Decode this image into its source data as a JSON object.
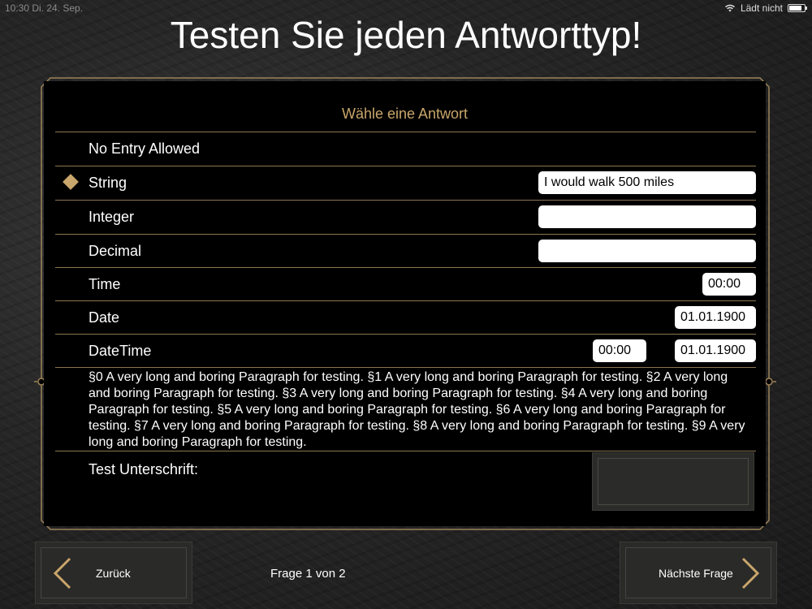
{
  "status": {
    "time": "10:30 Di. 24. Sep.",
    "charging": "Lädt nicht"
  },
  "title": "Testen Sie jeden Antworttyp!",
  "question": {
    "header": "Wähle eine Antwort"
  },
  "rows": [
    {
      "label": "No Entry Allowed"
    },
    {
      "label": "String",
      "selected": true,
      "value": "I would walk 500 miles"
    },
    {
      "label": "Integer",
      "value": ""
    },
    {
      "label": "Decimal",
      "value": ""
    },
    {
      "label": "Time",
      "value": "00:00"
    },
    {
      "label": "Date",
      "value": "01.01.1900"
    },
    {
      "label": "DateTime",
      "time": "00:00",
      "date": "01.01.1900"
    }
  ],
  "paragraph": "§0 A very long and boring Paragraph for testing. §1 A very long and boring Paragraph for testing. §2 A very long and boring Paragraph for testing. §3 A very long and boring Paragraph for testing. §4 A very long and boring Paragraph for testing. §5 A very long and boring Paragraph for testing. §6 A very long and boring Paragraph for testing. §7 A very long and boring Paragraph for testing. §8 A very long and boring Paragraph for testing. §9 A very long and boring Paragraph for testing.",
  "signature": {
    "label": "Test Unterschrift:"
  },
  "nav": {
    "back_label": "Zurück",
    "next_label": "Nächste Frage",
    "page_indicator": "Frage 1 von 2"
  },
  "colors": {
    "accent": "#c9a66b",
    "panel": "#000000",
    "button": "#2a2a28"
  },
  "icons": {
    "selected": "diamond-icon",
    "back": "chevron-left-icon",
    "next": "chevron-right-icon"
  }
}
